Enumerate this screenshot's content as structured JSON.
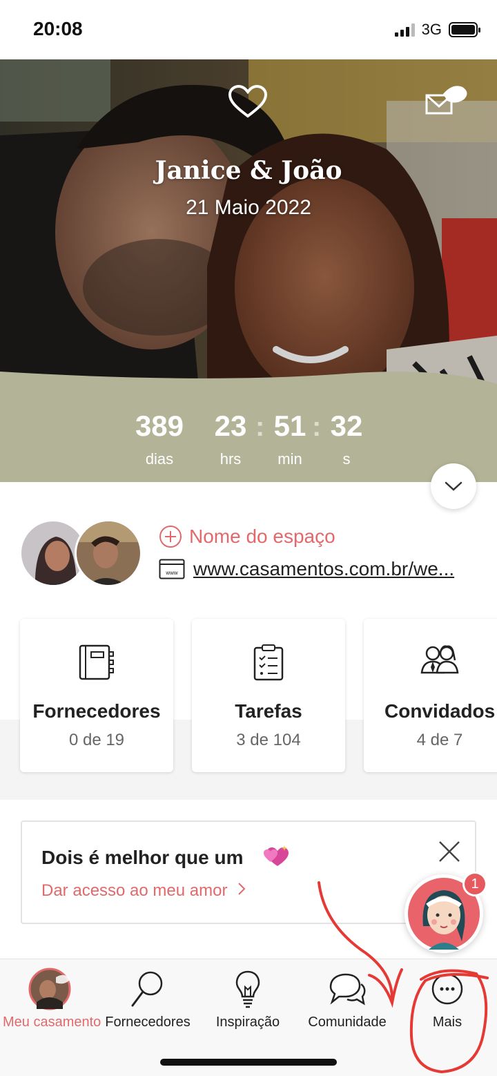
{
  "status_bar": {
    "time": "20:08",
    "network": "3G"
  },
  "hero": {
    "couple_names": "Janice & João",
    "wedding_date": "21 Maio 2022",
    "heart_icon": "heart-outline-icon",
    "mail_icon": "envelope-icon"
  },
  "countdown": {
    "days": "389",
    "days_label": "dias",
    "hours": "23",
    "hours_label": "hrs",
    "minutes": "51",
    "minutes_label": "min",
    "seconds": "32",
    "seconds_label": "s",
    "separator": ":"
  },
  "details": {
    "venue_label": "Nome do espaço",
    "website_url": "www.casamentos.com.br/we..."
  },
  "cards": [
    {
      "title": "Fornecedores",
      "count": "0 de 19",
      "icon": "notebook-icon"
    },
    {
      "title": "Tarefas",
      "count": "3 de 104",
      "icon": "checklist-icon"
    },
    {
      "title": "Convidados",
      "count": "4 de 7",
      "icon": "guests-icon"
    }
  ],
  "banner": {
    "title": "Dois é melhor que um",
    "link": "Dar acesso ao meu amor"
  },
  "chat": {
    "badge_count": "1"
  },
  "nav": {
    "items": [
      {
        "label": "Meu casamento",
        "icon": "profile-photo"
      },
      {
        "label": "Fornecedores",
        "icon": "search-icon"
      },
      {
        "label": "Inspiração",
        "icon": "lightbulb-icon"
      },
      {
        "label": "Comunidade",
        "icon": "chat-bubbles-icon"
      },
      {
        "label": "Mais",
        "icon": "more-icon"
      }
    ]
  },
  "colors": {
    "accent": "#e2696b",
    "countdown_band": "#b3b497",
    "badge": "#e65a5f",
    "annotation": "#e53935"
  }
}
